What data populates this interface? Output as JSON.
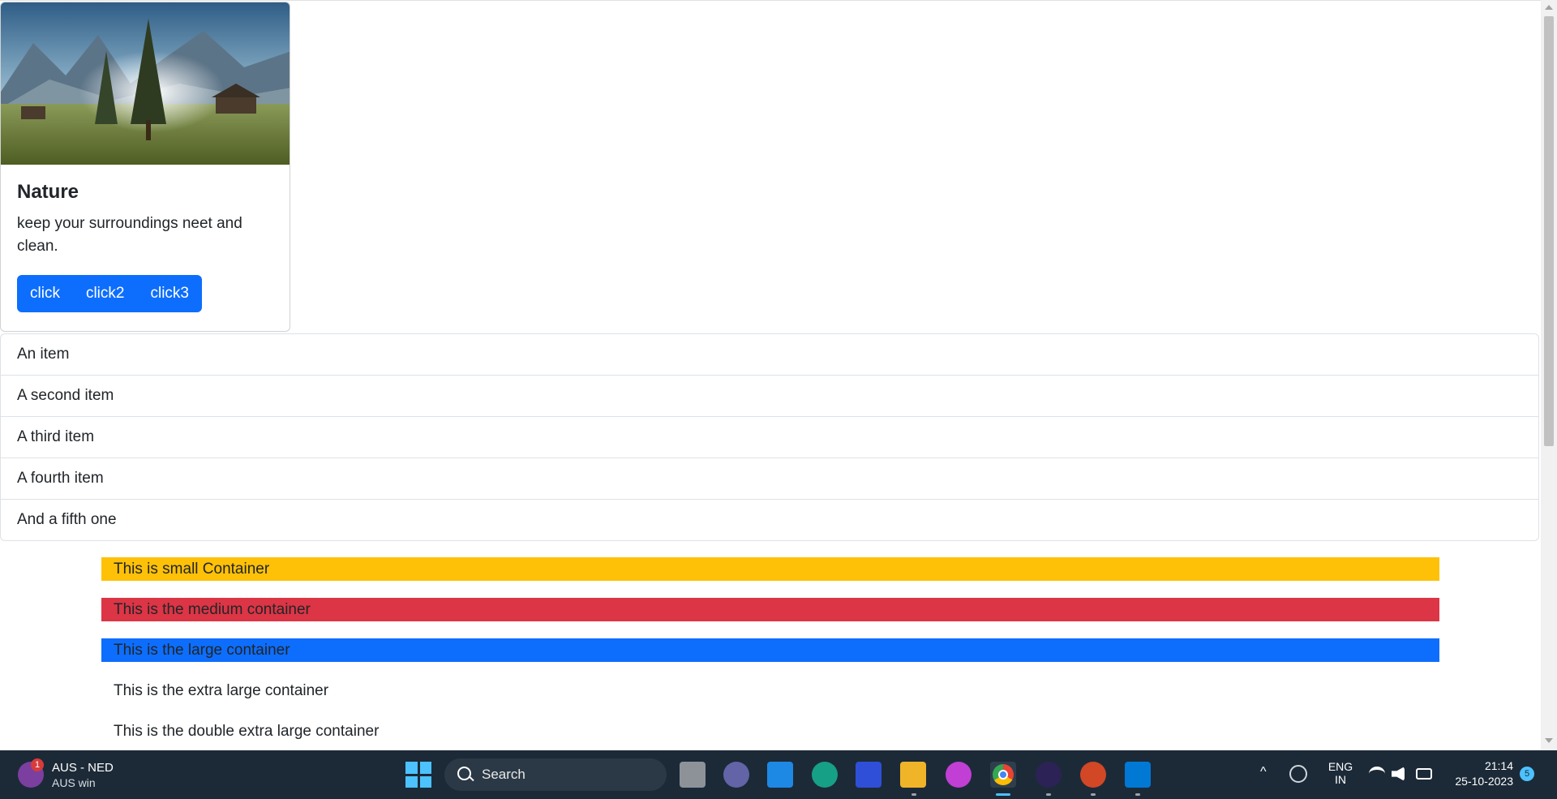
{
  "card": {
    "title": "Nature",
    "text": "keep your surroundings neet and clean.",
    "buttons": [
      "click",
      "click2",
      "click3"
    ]
  },
  "list_group": {
    "items": [
      "An item",
      "A second item",
      "A third item",
      "A fourth item",
      "And a fifth one"
    ]
  },
  "containers": [
    {
      "label": "This is small Container",
      "color": "#ffc107"
    },
    {
      "label": "This is the medium container",
      "color": "#dc3545"
    },
    {
      "label": "This is the large container",
      "color": "#0d6efd"
    },
    {
      "label": "This is the extra large container",
      "color": "transparent"
    },
    {
      "label": "This is the double extra large container",
      "color": "transparent"
    }
  ],
  "taskbar": {
    "weather": {
      "title": "AUS - NED",
      "subtitle": "AUS win",
      "badge": "1"
    },
    "search_placeholder": "Search",
    "apps": [
      "task-view-icon",
      "teams-chat-icon",
      "mail-icon",
      "edge-icon",
      "ai-app-icon",
      "file-explorer-icon",
      "wps-icon",
      "chrome-icon",
      "eclipse-icon",
      "powerpoint-icon",
      "vscode-icon"
    ],
    "language": {
      "line1": "ENG",
      "line2": "IN"
    },
    "clock": {
      "time": "21:14",
      "date": "25-10-2023"
    },
    "notifications": "5"
  }
}
